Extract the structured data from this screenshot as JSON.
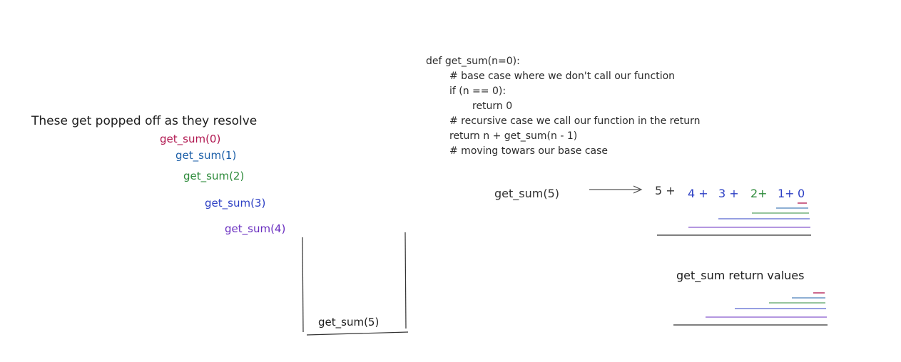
{
  "colors": {
    "ink": "#1e1e1e",
    "crimson": "#b0164f",
    "steelblue": "#1c5fa8",
    "green": "#2e8b3b",
    "blue": "#2c3fc4",
    "purple": "#6a2fc0"
  },
  "stack": {
    "heading": "These get popped off as they resolve",
    "popped": [
      "get_sum(0)",
      "get_sum(1)",
      "get_sum(2)",
      "get_sum(3)",
      "get_sum(4)"
    ],
    "base_frame": "get_sum(5)"
  },
  "code": {
    "lines": [
      "def get_sum(n=0):",
      "# base case where we don't call our function",
      "if (n == 0):",
      "return 0",
      "# recursive case we call our function in the return",
      "return n + get_sum(n - 1)",
      "# moving towars our base case"
    ]
  },
  "expansion": {
    "call": "get_sum(5)",
    "terms": [
      "5 +",
      "4 +",
      "3 +",
      "2+",
      "1+",
      "0"
    ]
  },
  "return_values": {
    "label": "get_sum return values"
  }
}
